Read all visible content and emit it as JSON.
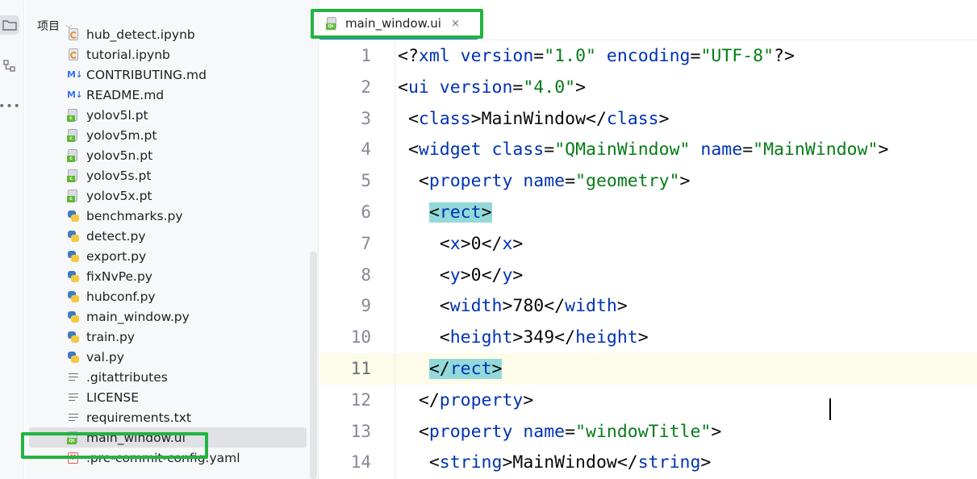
{
  "toolstrip": {
    "project_icon": "folder-icon",
    "structure_icon": "structure-icon",
    "more_label": "•••"
  },
  "project_panel": {
    "title": "项目",
    "title_chevron": "⌵",
    "files": [
      {
        "name": "hub_detect.ipynb",
        "icon": "notebook-icon"
      },
      {
        "name": "tutorial.ipynb",
        "icon": "notebook-icon"
      },
      {
        "name": "CONTRIBUTING.md",
        "icon": "markdown-icon"
      },
      {
        "name": "README.md",
        "icon": "markdown-icon"
      },
      {
        "name": "yolov5l.pt",
        "icon": "pt-file-icon"
      },
      {
        "name": "yolov5m.pt",
        "icon": "pt-file-icon"
      },
      {
        "name": "yolov5n.pt",
        "icon": "pt-file-icon"
      },
      {
        "name": "yolov5s.pt",
        "icon": "pt-file-icon"
      },
      {
        "name": "yolov5x.pt",
        "icon": "pt-file-icon"
      },
      {
        "name": "benchmarks.py",
        "icon": "python-icon"
      },
      {
        "name": "detect.py",
        "icon": "python-icon"
      },
      {
        "name": "export.py",
        "icon": "python-icon"
      },
      {
        "name": "fixNvPe.py",
        "icon": "python-icon"
      },
      {
        "name": "hubconf.py",
        "icon": "python-icon"
      },
      {
        "name": "main_window.py",
        "icon": "python-icon"
      },
      {
        "name": "train.py",
        "icon": "python-icon"
      },
      {
        "name": "val.py",
        "icon": "python-icon"
      },
      {
        "name": ".gitattributes",
        "icon": "text-file-icon"
      },
      {
        "name": "LICENSE",
        "icon": "text-file-icon"
      },
      {
        "name": "requirements.txt",
        "icon": "text-file-icon"
      },
      {
        "name": "main_window.ui",
        "icon": "qt-ui-file-icon"
      },
      {
        "name": ".pre-commit-config.yaml",
        "icon": "yaml-file-icon"
      }
    ],
    "md_badge": "M↓",
    "pt_badge": "c",
    "qt_badge": "Qt",
    "yaml_badge": "Y"
  },
  "editor": {
    "tab_title": "main_window.ui",
    "tab_close": "×",
    "tab_icon": "qt-ui-file-icon",
    "caret_line": 11,
    "lines": [
      {
        "n": "1",
        "tokens": [
          [
            "pl",
            "<?"
          ],
          [
            "kw",
            "xml "
          ],
          [
            "kw",
            "version"
          ],
          [
            "pl",
            "="
          ],
          [
            "str",
            "\"1.0\""
          ],
          [
            "pl",
            " "
          ],
          [
            "kw",
            "encoding"
          ],
          [
            "pl",
            "="
          ],
          [
            "str",
            "\"UTF-8\""
          ],
          [
            "pl",
            "?>"
          ]
        ]
      },
      {
        "n": "2",
        "tokens": [
          [
            "pl",
            "<"
          ],
          [
            "kw",
            "ui "
          ],
          [
            "kw",
            "version"
          ],
          [
            "pl",
            "="
          ],
          [
            "str",
            "\"4.0\""
          ],
          [
            "pl",
            ">"
          ]
        ]
      },
      {
        "n": "3",
        "tokens": [
          [
            "pl",
            " <"
          ],
          [
            "kw",
            "class"
          ],
          [
            "pl",
            ">MainWindow</"
          ],
          [
            "kw",
            "class"
          ],
          [
            "pl",
            ">"
          ]
        ]
      },
      {
        "n": "4",
        "tokens": [
          [
            "pl",
            " <"
          ],
          [
            "kw",
            "widget "
          ],
          [
            "kw",
            "class"
          ],
          [
            "pl",
            "="
          ],
          [
            "str",
            "\"QMainWindow\""
          ],
          [
            "pl",
            " "
          ],
          [
            "kw",
            "name"
          ],
          [
            "pl",
            "="
          ],
          [
            "str",
            "\"MainWindow\""
          ],
          [
            "pl",
            ">"
          ]
        ]
      },
      {
        "n": "5",
        "tokens": [
          [
            "pl",
            "  <"
          ],
          [
            "kw",
            "property "
          ],
          [
            "kw",
            "name"
          ],
          [
            "pl",
            "="
          ],
          [
            "str",
            "\"geometry\""
          ],
          [
            "pl",
            ">"
          ]
        ]
      },
      {
        "n": "6",
        "tokens": [
          [
            "pl",
            "   "
          ],
          [
            "match",
            "<"
          ],
          [
            "kwm",
            "rect"
          ],
          [
            "match",
            ">"
          ]
        ]
      },
      {
        "n": "7",
        "tokens": [
          [
            "pl",
            "    <"
          ],
          [
            "kw",
            "x"
          ],
          [
            "pl",
            ">0</"
          ],
          [
            "kw",
            "x"
          ],
          [
            "pl",
            ">"
          ]
        ]
      },
      {
        "n": "8",
        "tokens": [
          [
            "pl",
            "    <"
          ],
          [
            "kw",
            "y"
          ],
          [
            "pl",
            ">0</"
          ],
          [
            "kw",
            "y"
          ],
          [
            "pl",
            ">"
          ]
        ]
      },
      {
        "n": "9",
        "tokens": [
          [
            "pl",
            "    <"
          ],
          [
            "kw",
            "width"
          ],
          [
            "pl",
            ">780</"
          ],
          [
            "kw",
            "width"
          ],
          [
            "pl",
            ">"
          ]
        ]
      },
      {
        "n": "10",
        "tokens": [
          [
            "pl",
            "    <"
          ],
          [
            "kw",
            "height"
          ],
          [
            "pl",
            ">349</"
          ],
          [
            "kw",
            "height"
          ],
          [
            "pl",
            ">"
          ]
        ]
      },
      {
        "n": "11",
        "tokens": [
          [
            "pl",
            "   "
          ],
          [
            "match",
            "</"
          ],
          [
            "kwm",
            "rect"
          ],
          [
            "match",
            ">"
          ]
        ]
      },
      {
        "n": "12",
        "tokens": [
          [
            "pl",
            "  </"
          ],
          [
            "kw",
            "property"
          ],
          [
            "pl",
            ">"
          ]
        ]
      },
      {
        "n": "13",
        "tokens": [
          [
            "pl",
            "  <"
          ],
          [
            "kw",
            "property "
          ],
          [
            "kw",
            "name"
          ],
          [
            "pl",
            "="
          ],
          [
            "str",
            "\"windowTitle\""
          ],
          [
            "pl",
            ">"
          ]
        ]
      },
      {
        "n": "14",
        "tokens": [
          [
            "pl",
            "   <"
          ],
          [
            "kw",
            "string"
          ],
          [
            "pl",
            ">MainWindow</"
          ],
          [
            "kw",
            "string"
          ],
          [
            "pl",
            ">"
          ]
        ]
      }
    ]
  },
  "colors": {
    "highlight_box": "#22b43f",
    "keyword": "#0033b3",
    "string": "#067d17",
    "tag_match": "#93d9d9",
    "caret_line_bg": "#fdfbe9",
    "tab_underline": "#3574f0"
  }
}
